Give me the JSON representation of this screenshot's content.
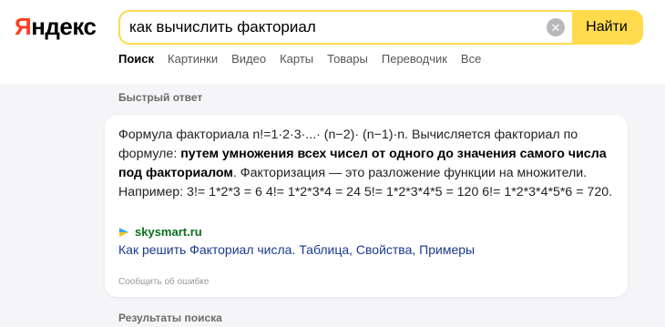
{
  "logo": {
    "first_letter": "Я",
    "rest": "ндекс"
  },
  "search": {
    "value": "как вычислить факториал",
    "button_label": "Найти",
    "clear_glyph": "✕"
  },
  "tabs": [
    {
      "label": "Поиск",
      "active": true
    },
    {
      "label": "Картинки"
    },
    {
      "label": "Видео"
    },
    {
      "label": "Карты"
    },
    {
      "label": "Товары"
    },
    {
      "label": "Переводчик"
    },
    {
      "label": "Все"
    }
  ],
  "quick_answer": {
    "title": "Быстрый ответ",
    "text_part1": "Формула факториала n!=1·2·3·...· (n−2)· (n−1)·n. Вычисляется факториал по формуле: ",
    "text_bold": "путем умножения всех чисел от одного до значения самого числа под факториалом",
    "text_part2": ". Факторизация — это разложение функции на множители. Например: 3!= 1*2*3 = 6 4!= 1*2*3*4 = 24 5!= 1*2*3*4*5 = 120 6!= 1*2*3*4*5*6 = 720.",
    "source_domain": "skysmart.ru",
    "source_title": "Как решить Факториал числа. Таблица, Свойства, Примеры",
    "report_label": "Сообщить об ошибке"
  },
  "results_title": "Результаты поиска",
  "colors": {
    "brand_red": "#fc3f1d",
    "search_yellow": "#ffdb4d",
    "source_green": "#0a6e1a",
    "link_blue": "#1a3a8f"
  }
}
